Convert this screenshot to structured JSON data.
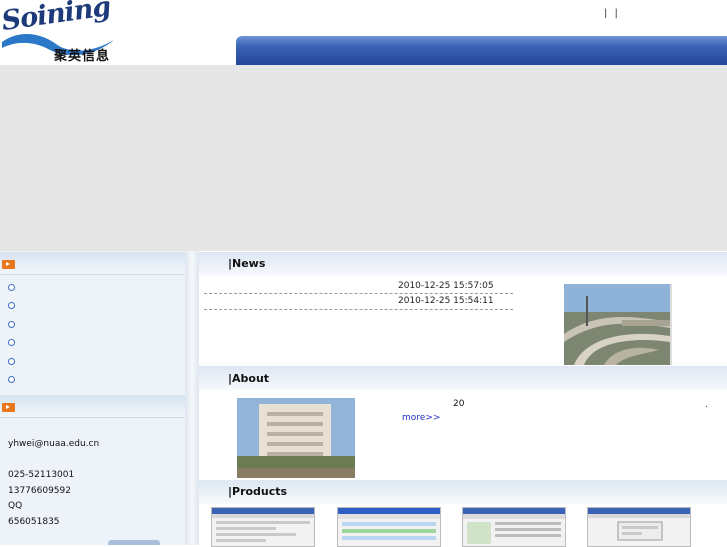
{
  "header": {
    "logo_script": "Soining",
    "logo_cn": "聚英信息",
    "top_links": "| |"
  },
  "sidebar": {
    "contact": {
      "email": "yhwei@nuaa.edu.cn",
      "phone": "025-52113001",
      "mobile": "13776609592",
      "qq_label": "QQ",
      "qq": "656051835"
    }
  },
  "news": {
    "title": "|News",
    "items": [
      {
        "date": "2010-12-25 15:57:05"
      },
      {
        "date": "2010-12-25 15:54:11"
      }
    ]
  },
  "about": {
    "title": "|About",
    "text": "20",
    "more": "more>>",
    "dot": "."
  },
  "products": {
    "title": "|Products"
  },
  "colors": {
    "banner_blue": "#2d4fa3",
    "accent_orange": "#e8761a",
    "link_blue": "#2233cc"
  }
}
